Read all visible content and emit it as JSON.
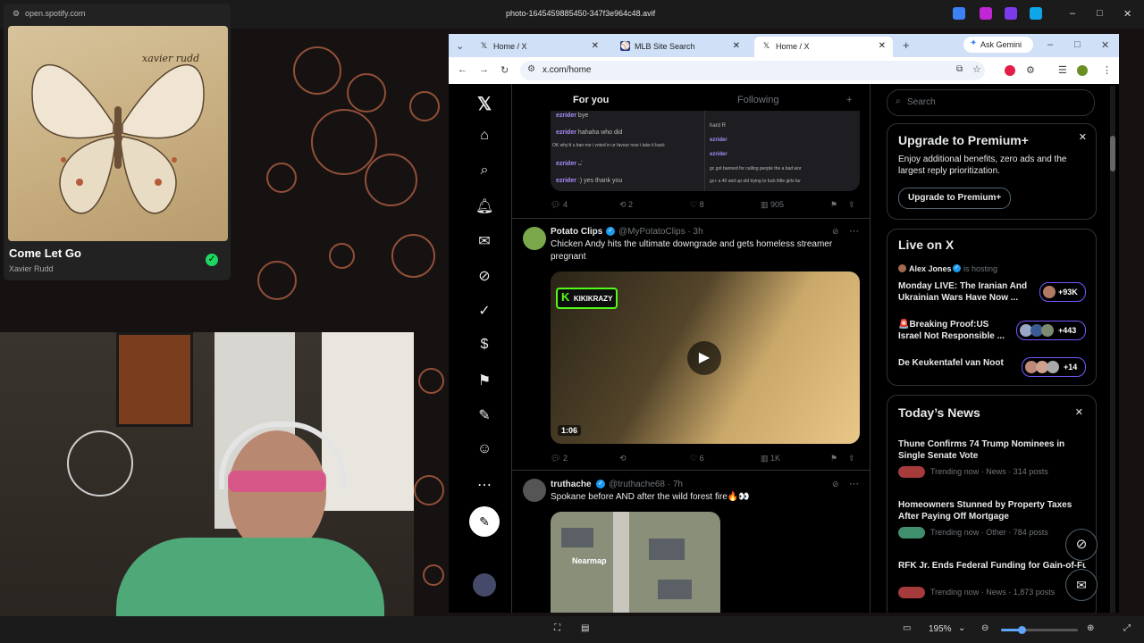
{
  "viewer": {
    "title": "photo-1645459885450-347f3e964c48.avif",
    "zoom": "195%",
    "window_min": "–",
    "window_max": "□",
    "window_close": "✕"
  },
  "spotify": {
    "url": "open.spotify.com",
    "song": "Come Let Go",
    "artist": "Xavier Rudd",
    "album_art_text": "xavier rudd"
  },
  "browser": {
    "tabs": [
      {
        "label": "Home / X",
        "active": false
      },
      {
        "label": "MLB Site Search",
        "active": false
      },
      {
        "label": "Home / X",
        "active": true
      }
    ],
    "new_tab": "+",
    "gemini": "Ask Gemini",
    "url": "x.com/home"
  },
  "x": {
    "feed_tabs": {
      "for_you": "For you",
      "following": "Following"
    },
    "chat_post": {
      "lines": [
        {
          "user": "ezrider",
          "text": "bye"
        },
        {
          "user": "ezrider",
          "text": "hahaha who did"
        },
        {
          "user": "",
          "text": "OK why'd u ban me i voted in ur favour now i take it back"
        },
        {
          "user": "ezrider",
          "text": "ᴗ̈"
        },
        {
          "user": "ezrider",
          "text": ":) yes thank you"
        }
      ],
      "right_lines": [
        "hard R",
        "ezrider",
        "ezrider",
        "gc got banned for calling people the a bad wor",
        "gc+ a 40 and up old trying to fuck little girls fur"
      ],
      "actions": {
        "replies": "4",
        "reposts": "2",
        "likes": "8",
        "views": "905"
      }
    },
    "post1": {
      "name": "Potato Clips",
      "handle": "@MyPotatoClips · 3h",
      "text": "Chicken Andy hits the ultimate downgrade and gets homeless streamer pregnant",
      "video_duration": "1:06",
      "kick_badge": "KIKIKRAZY",
      "actions": {
        "replies": "2",
        "reposts": "",
        "likes": "6",
        "views": "1K"
      }
    },
    "post2": {
      "name": "truthache",
      "handle": "@truthache68 · 7h",
      "text": "Spokane before AND after the wild forest fire🔥👀",
      "map_label": "Nearmap"
    },
    "search_placeholder": "Search",
    "premium": {
      "title": "Upgrade to Premium+",
      "body": "Enjoy additional benefits, zero ads and the largest reply prioritization.",
      "button": "Upgrade to Premium+"
    },
    "live": {
      "title": "Live on X",
      "host": "Alex Jones",
      "host_suffix": "is hosting",
      "items": [
        {
          "title": "Monday LIVE: The Iranian And Ukrainian Wars Have Now ...",
          "count": "+93K"
        },
        {
          "title": "🚨Breaking Proof:US Israel Not Responsible ...",
          "count": "+443"
        },
        {
          "title": "De Keukentafel van Noot",
          "count": "+14"
        }
      ]
    },
    "news": {
      "title": "Today’s News",
      "items": [
        {
          "title": "Thune Confirms 74 Trump Nominees in Single Senate Vote",
          "meta": "Trending now · News · 314 posts"
        },
        {
          "title": "Homeowners Stunned by Property Taxes After Paying Off Mortgage",
          "meta": "Trending now · Other · 784 posts"
        },
        {
          "title": "RFK Jr. Ends Federal Funding for Gain-of-Function Research, Links Diseases to La",
          "meta": "Trending now · News · 1,873 posts"
        }
      ]
    }
  }
}
